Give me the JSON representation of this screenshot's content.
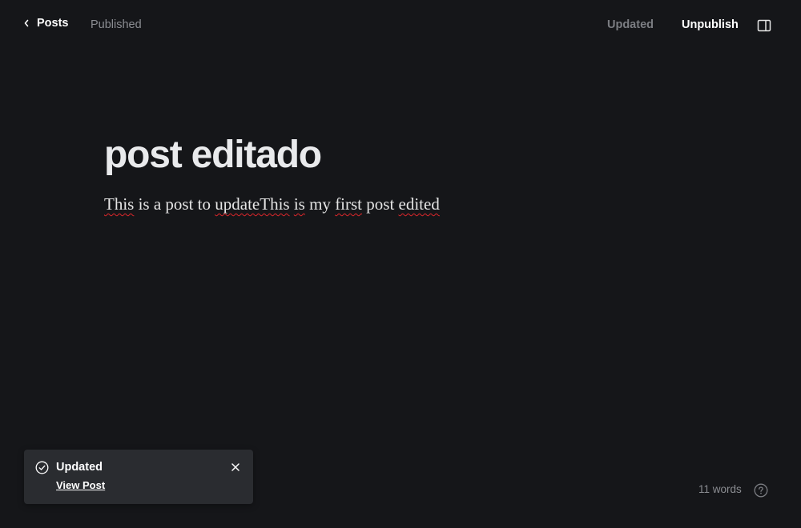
{
  "header": {
    "back_label": "Posts",
    "post_status": "Published",
    "save_state": "Updated",
    "unpublish_label": "Unpublish"
  },
  "editor": {
    "title": "post editado",
    "body_segments": [
      {
        "text": "This",
        "misspelled": true
      },
      {
        "text": " is a post to ",
        "misspelled": false
      },
      {
        "text": "updateThis",
        "misspelled": true
      },
      {
        "text": " ",
        "misspelled": false
      },
      {
        "text": "is",
        "misspelled": true
      },
      {
        "text": " my ",
        "misspelled": false
      },
      {
        "text": "first",
        "misspelled": true
      },
      {
        "text": " post ",
        "misspelled": false
      },
      {
        "text": "edited",
        "misspelled": true
      }
    ]
  },
  "toast": {
    "title": "Updated",
    "link_label": "View Post",
    "icon": "check-circle-icon",
    "close_icon": "close-icon"
  },
  "footer": {
    "word_count": "11 words",
    "help_icon": "question-circle-icon"
  },
  "colors": {
    "background": "#151619",
    "toast_background": "#2a2c30",
    "text_primary": "#ffffff",
    "text_muted": "#8b8d92",
    "spellcheck_underline": "#e0262a"
  }
}
